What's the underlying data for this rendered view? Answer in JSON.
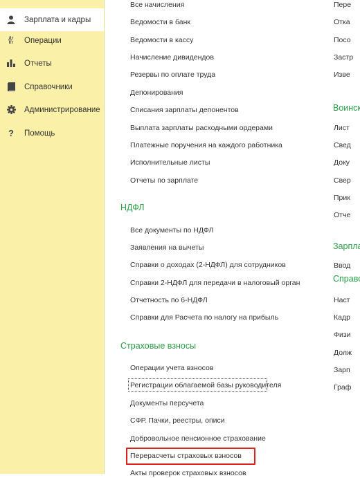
{
  "sidebar": {
    "items": [
      {
        "label": "Зарплата и кадры",
        "icon": "person-icon"
      },
      {
        "label": "Операции",
        "icon": "debit-credit-icon",
        "icon_text_top": "Дт",
        "icon_text_bottom": "Кт"
      },
      {
        "label": "Отчеты",
        "icon": "bar-chart-icon"
      },
      {
        "label": "Справочники",
        "icon": "book-icon"
      },
      {
        "label": "Администрирование",
        "icon": "gear-icon"
      },
      {
        "label": "Помощь",
        "icon": "question-icon",
        "icon_text": "?"
      }
    ]
  },
  "col1": {
    "salary_links": [
      "Все начисления",
      "Ведомости в банк",
      "Ведомости в кассу",
      "Начисление дивидендов",
      "Резервы по оплате труда",
      "Депонирования",
      "Списания зарплаты депонентов",
      "Выплата зарплаты расходными ордерами",
      "Платежные поручения на каждого работника",
      "Исполнительные листы",
      "Отчеты по зарплате"
    ],
    "ndfl_title": "НДФЛ",
    "ndfl_links": [
      "Все документы по НДФЛ",
      "Заявления на вычеты",
      "Справки о доходах (2-НДФЛ) для сотрудников",
      "Справки 2-НДФЛ для передачи в налоговый орган",
      "Отчетность по 6-НДФЛ",
      "Справки для Расчета по налогу на прибыль"
    ],
    "insurance_title": "Страховые взносы",
    "insurance_links": [
      "Операции учета взносов",
      "Регистрации облагаемой базы руководителя",
      "Документы персучета",
      "СФР. Пачки, реестры, описи",
      "Добровольное пенсионное страхование",
      "Перерасчеты страховых взносов",
      "Акты проверок страховых взносов"
    ]
  },
  "col2": {
    "top_links": [
      "Пере",
      "Отка",
      "Посо",
      "Застр",
      "Изве"
    ],
    "military_title": "Воинск",
    "military_links": [
      "Лист",
      "Свед",
      "Доку",
      "Свер",
      "Прик",
      "Отче"
    ],
    "salary_title": "Зарпла",
    "salary_links": [
      "Ввод"
    ],
    "reference_title": "Справо",
    "reference_links": [
      "Наст",
      "Кадр",
      "Физи",
      "Долж",
      "Зарп",
      "Граф"
    ]
  },
  "colors": {
    "sidebar_bg": "#fbf0a8",
    "section_title": "#2a9d48",
    "highlight_border": "#e0201b"
  }
}
